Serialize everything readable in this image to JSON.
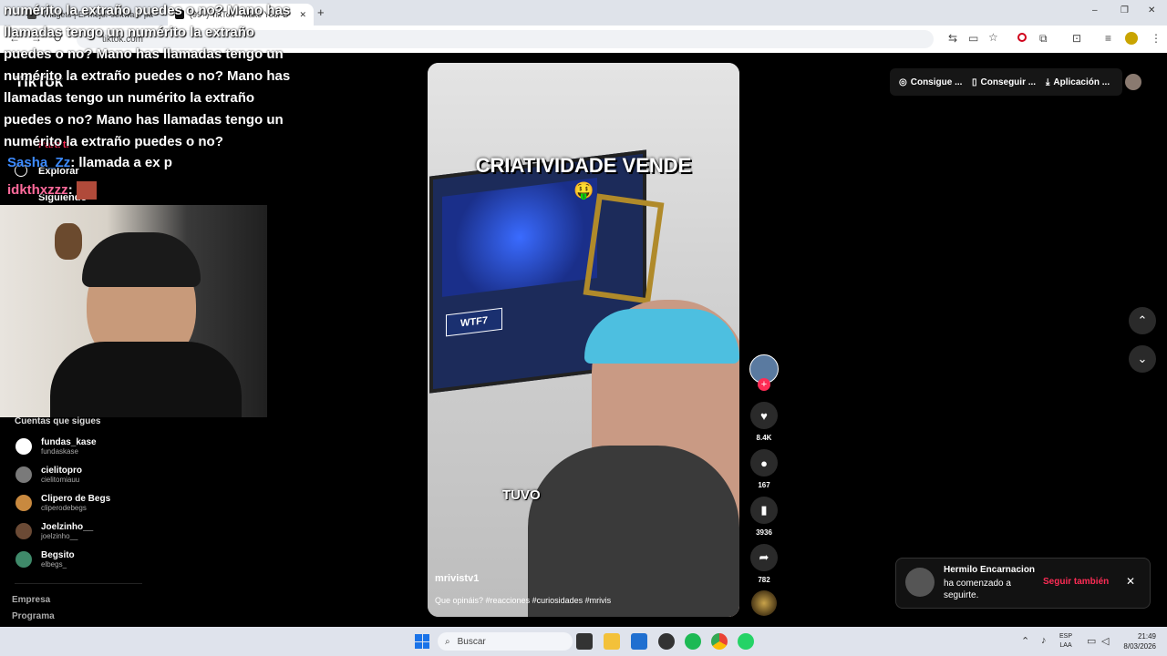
{
  "browser": {
    "tabs": [
      {
        "label": "Widgets | El mejor software pa"
      },
      {
        "label": "(99+) TikTok - Make Your D"
      }
    ],
    "url": "tiktok.com",
    "window_controls": [
      "–",
      "❐",
      "✕"
    ]
  },
  "tiktok": {
    "logo": "TikTok",
    "nav": [
      {
        "label": "Para ti"
      },
      {
        "label": "Explorar"
      },
      {
        "label": "Siguiendo"
      }
    ],
    "following_title": "Cuentas que sigues",
    "accounts": [
      {
        "name": "fundas_kase",
        "user": "fundaskase",
        "color": "#ffffff"
      },
      {
        "name": "cielitopro",
        "user": "cielitomiauu",
        "color": "#7a7a7a"
      },
      {
        "name": "Clipero de Begs",
        "user": "cliperodebegs",
        "color": "#c8893f"
      },
      {
        "name": "Joelzinho__",
        "user": "joelzinho__",
        "color": "#6b4a35"
      },
      {
        "name": "Begsito",
        "user": "elbegs_",
        "color": "#3f8a6a"
      }
    ],
    "footer_links": [
      "Empresa",
      "Programa"
    ],
    "top_buttons": [
      {
        "label": "Consigue ..."
      },
      {
        "label": "Conseguir ..."
      },
      {
        "label": "Aplicación ..."
      }
    ],
    "video": {
      "caption_top": "CRIATIVIDADE VENDE",
      "emoji": "🤑",
      "caption_mid": "TUVO",
      "author": "mrivistv1",
      "description": "Que opináis? #reacciones #curiosidades #mrivis",
      "news_logo": "WTF7"
    },
    "actions": {
      "likes": "8.4K",
      "comments": "167",
      "saves": "3936",
      "shares": "782"
    }
  },
  "notification": {
    "name": "Hermilo Encarnacion",
    "text": "ha comenzado a seguirte.",
    "action": "Seguir también"
  },
  "stream_overlay": {
    "chat_message": "numérito la extraño puedes o no? Mano has llamadas tengo un numérito la extraño puedes o no? Mano has llamadas tengo un numérito la extraño puedes o no? Mano has llamadas tengo un numérito la extraño puedes o no? Mano has llamadas tengo un numérito la extraño puedes o no?",
    "chat_lines": [
      {
        "user": "Sasha_Zz",
        "text": ": llamada a ex p",
        "color": "#3d8bff"
      },
      {
        "user": "idkthxzzz",
        "text": ":",
        "color": "#ff6a9b"
      }
    ]
  },
  "taskbar": {
    "search_placeholder": "Buscar",
    "lang_top": "ESP",
    "lang_bottom": "LAA",
    "time": "21:49",
    "date": "8/03/2026"
  }
}
